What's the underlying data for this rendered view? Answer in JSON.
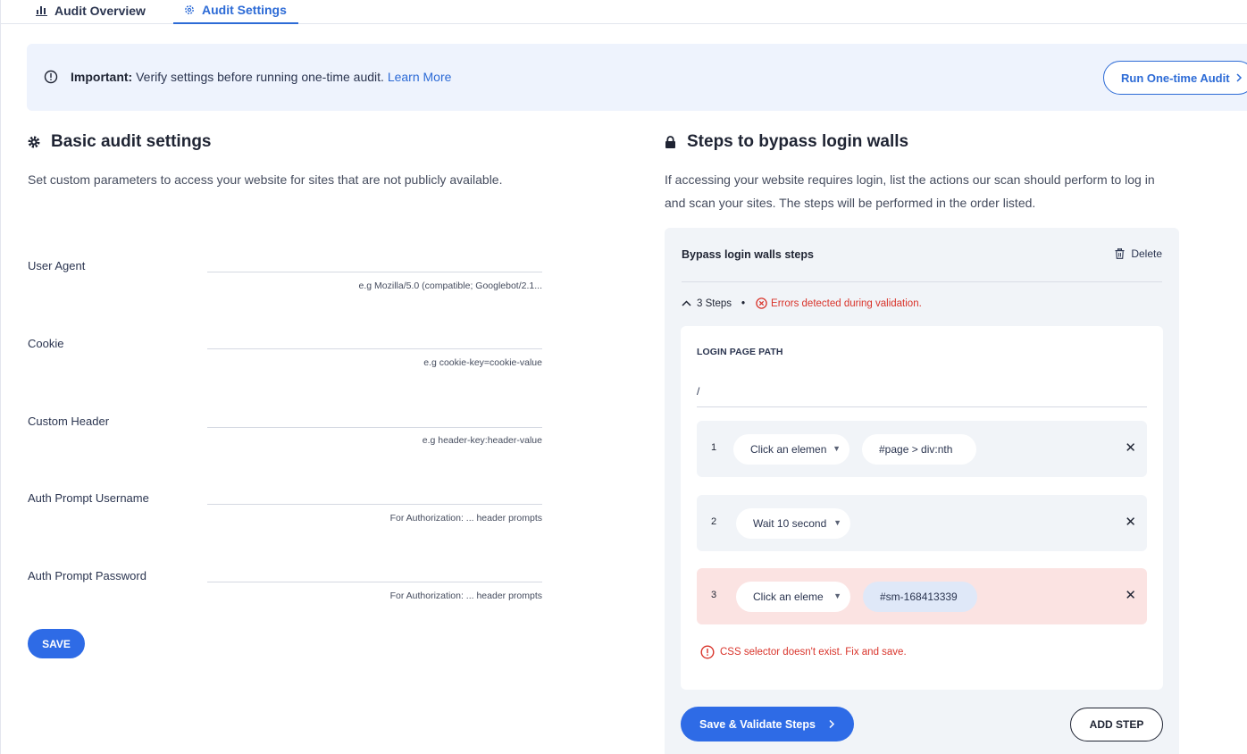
{
  "tabs": [
    {
      "label": "Audit Overview",
      "icon": "bar-chart-icon",
      "active": false
    },
    {
      "label": "Audit Settings",
      "icon": "gear-icon",
      "active": true
    }
  ],
  "banner": {
    "strong": "Important:",
    "message": " Verify settings before running one-time audit. ",
    "link": "Learn More",
    "run_button": "Run One-time Audit",
    "run_button_icon": "chevron-right-icon"
  },
  "basic": {
    "title": "Basic audit settings",
    "title_icon": "gear-icon",
    "description": "Set custom parameters to access your website for sites that are not publicly available.",
    "fields": [
      {
        "label": "User Agent",
        "value": "",
        "hint": "e.g Mozilla/5.0 (compatible; Googlebot/2.1..."
      },
      {
        "label": "Cookie",
        "value": "",
        "hint": "e.g cookie-key=cookie-value"
      },
      {
        "label": "Custom Header",
        "value": "",
        "hint": "e.g header-key:header-value"
      },
      {
        "label": "Auth Prompt Username",
        "value": "",
        "hint": "For Authorization: ... header prompts"
      },
      {
        "label": "Auth Prompt Password",
        "value": "",
        "hint": "For Authorization: ... header prompts"
      }
    ],
    "save_button": "SAVE"
  },
  "bypass": {
    "title": "Steps to bypass login walls",
    "title_icon": "lock-icon",
    "description": "If accessing your website requires login, list the actions our scan should perform to log in and scan your sites. The steps will be performed in the order listed.",
    "panel_title": "Bypass login walls steps",
    "delete_label": "Delete",
    "steps_count": "3 Steps",
    "separator": "•",
    "validation_error": "Errors detected during validation.",
    "login_page_path_label": "LOGIN PAGE PATH",
    "login_page_path_value": "/",
    "steps": [
      {
        "number": "1",
        "action": "Click an elemen",
        "selector": "#page > div:nth",
        "error": false
      },
      {
        "number": "2",
        "action": "Wait 10 second",
        "selector": "",
        "error": false
      },
      {
        "number": "3",
        "action": "Click an eleme",
        "selector": "#sm-168413339",
        "error": true
      }
    ],
    "remove_symbol": "✕",
    "caret_symbol": "▼",
    "step_error": "CSS selector doesn't exist. Fix and save.",
    "validate_button": "Save & Validate Steps",
    "add_step_button": "ADD STEP"
  },
  "colors": {
    "accent": "#2e6be6",
    "error": "#d9342b",
    "banner_bg": "#eef3fd",
    "panel_bg": "#f1f4f8",
    "error_row_bg": "#fbe3e2"
  }
}
